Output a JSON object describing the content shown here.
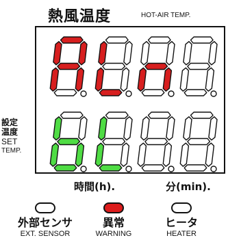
{
  "header": {
    "title_jp": "熱風温度",
    "title_en": "HOT-AIR TEMP."
  },
  "display": {
    "top_row": [
      "A",
      "L",
      "n",
      ""
    ],
    "bottom_row": [
      "b",
      "L",
      "",
      ""
    ],
    "top_color": "#d71f1f",
    "bottom_color": "#4fdc44",
    "off_segment_color": "#ffffff"
  },
  "side_label": {
    "line1": "設定",
    "line2": "温度",
    "line3": "SET",
    "line4": "TEMP."
  },
  "units": {
    "hours": "時間(h).",
    "minutes": "分(min)."
  },
  "indicators": [
    {
      "jp": "外部センサ",
      "en": "EXT. SENSOR",
      "on": false,
      "color": "#ffffff"
    },
    {
      "jp": "異常",
      "en": "WARNING",
      "on": true,
      "color": "#dd1c1c"
    },
    {
      "jp": "ヒータ",
      "en": "HEATER",
      "on": false,
      "color": "#ffffff"
    }
  ]
}
